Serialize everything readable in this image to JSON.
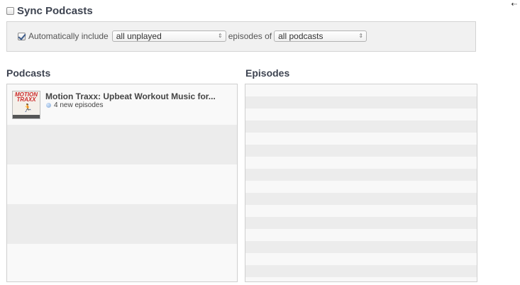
{
  "sync": {
    "title": "Sync Podcasts",
    "checked": false
  },
  "corner_icon": "arrow-icon",
  "options": {
    "auto_include_label": "Automatically include",
    "auto_include_checked": true,
    "count_select": "all unplayed",
    "episodes_of_label": "episodes of",
    "scope_select": "all podcasts"
  },
  "podcasts": {
    "title": "Podcasts",
    "items": [
      {
        "name": "Motion Traxx: Upbeat Workout Music for...",
        "episodes": "4 new episodes",
        "artwork_text": "MOTION TRAXX",
        "artwork_icon": "runner-icon"
      }
    ]
  },
  "episodes": {
    "title": "Episodes"
  }
}
